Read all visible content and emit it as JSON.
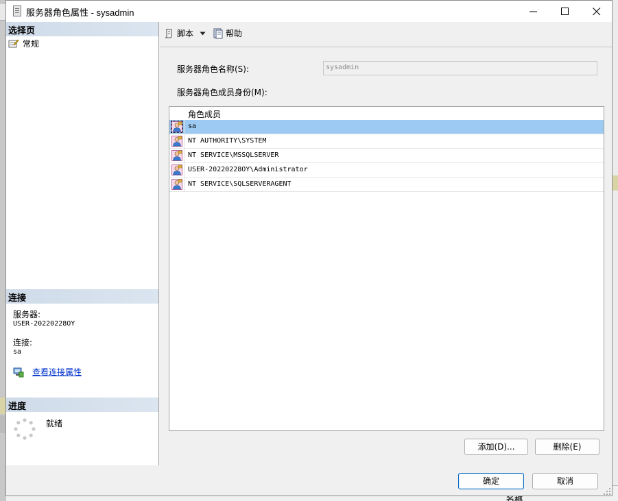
{
  "window": {
    "title": "服务器角色属性 - sysadmin"
  },
  "left_pane": {
    "select_page_header": "选择页",
    "pages": [
      {
        "label": "常规",
        "icon": "general-page-icon"
      }
    ],
    "connection_header": "连接",
    "server_label": "服务器:",
    "server_value": "USER-20220228OY",
    "connection_label": "连接:",
    "connection_value": "sa",
    "view_connection_link": "查看连接属性",
    "progress_header": "进度",
    "progress_status": "就绪"
  },
  "toolbar": {
    "script_label": "脚本",
    "help_label": "帮助"
  },
  "form": {
    "role_name_label": "服务器角色名称(S):",
    "role_name_value": "sysadmin",
    "members_label": "服务器角色成员身份(M):",
    "members_column_header": "角色成员",
    "members": [
      {
        "name": "sa",
        "selected": true
      },
      {
        "name": "NT AUTHORITY\\SYSTEM",
        "selected": false
      },
      {
        "name": "NT SERVICE\\MSSQLSERVER",
        "selected": false
      },
      {
        "name": "USER-20220228OY\\Administrator",
        "selected": false
      },
      {
        "name": "NT SERVICE\\SQLSERVERAGENT",
        "selected": false
      }
    ],
    "add_button": "添加(D)...",
    "remove_button": "删除(E)"
  },
  "footer": {
    "ok_button": "确定",
    "cancel_button": "取消"
  },
  "background": {
    "bottom_right_label": "名称"
  },
  "colors": {
    "selection": "#9dcaf2",
    "section_header": "#d6e1ee",
    "link": "#0033cc"
  }
}
